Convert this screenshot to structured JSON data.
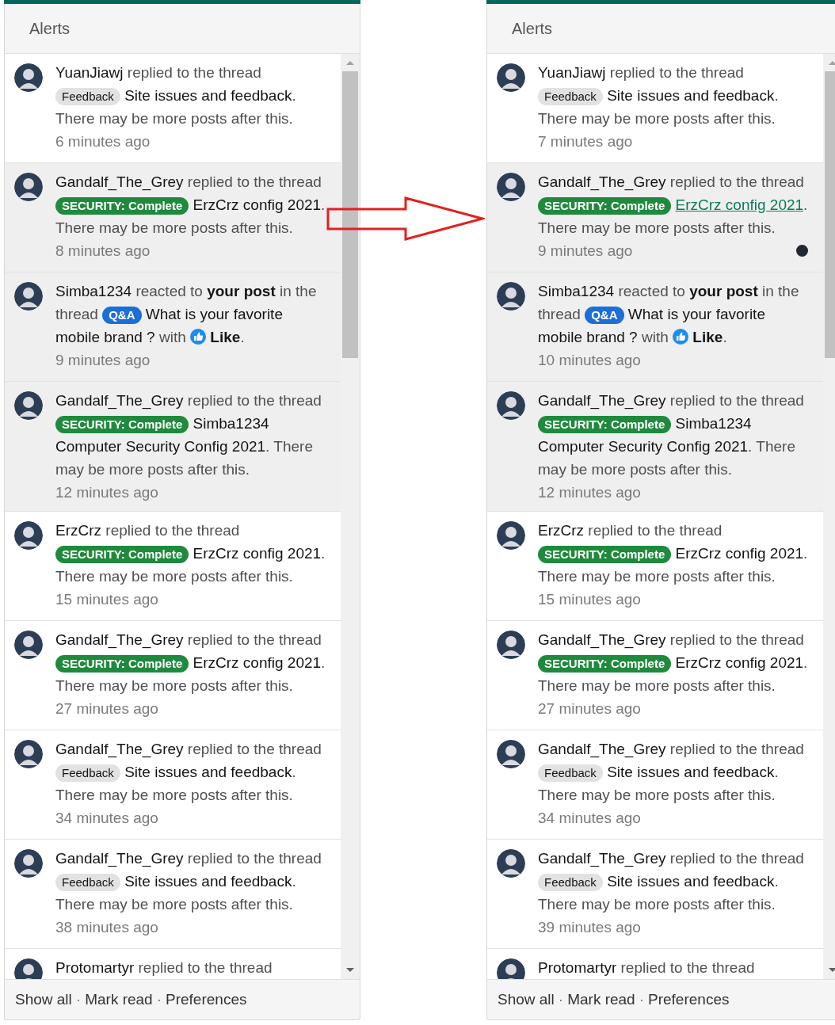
{
  "panels": [
    {
      "title": "Alerts",
      "items": [
        {
          "unread": false,
          "hovered": false,
          "segments": [
            {
              "kind": "user",
              "text": "YuanJiawj"
            },
            {
              "kind": "text",
              "text": " replied to the thread "
            },
            {
              "kind": "label",
              "text": "Feedback"
            },
            {
              "kind": "title",
              "text": "Site issues and feedback"
            },
            {
              "kind": "text",
              "text": ". There may be more posts after this."
            }
          ],
          "time": "6 minutes ago"
        },
        {
          "unread": true,
          "hovered": false,
          "segments": [
            {
              "kind": "user",
              "text": "Gandalf_The_Grey"
            },
            {
              "kind": "text",
              "text": " replied to the thread "
            },
            {
              "kind": "status",
              "text": "SECURITY: Complete"
            },
            {
              "kind": "title",
              "text": "ErzCrz config 2021"
            },
            {
              "kind": "text",
              "text": ". There may be more posts after this."
            }
          ],
          "time": "8 minutes ago"
        },
        {
          "unread": true,
          "hovered": false,
          "segments": [
            {
              "kind": "user",
              "text": "Simba1234"
            },
            {
              "kind": "text",
              "text": " reacted to "
            },
            {
              "kind": "bold",
              "text": "your post"
            },
            {
              "kind": "text",
              "text": " in the thread "
            },
            {
              "kind": "category",
              "text": "Q&A"
            },
            {
              "kind": "title",
              "text": "What is your favorite mobile brand ?"
            },
            {
              "kind": "text",
              "text": " with "
            },
            {
              "kind": "like"
            },
            {
              "kind": "bold",
              "text": "Like"
            },
            {
              "kind": "text",
              "text": "."
            }
          ],
          "time": "9 minutes ago"
        },
        {
          "unread": true,
          "hovered": false,
          "segments": [
            {
              "kind": "user",
              "text": "Gandalf_The_Grey"
            },
            {
              "kind": "text",
              "text": " replied to the thread "
            },
            {
              "kind": "status",
              "text": "SECURITY: Complete"
            },
            {
              "kind": "title",
              "text": "Simba1234 Computer Security Config 2021"
            },
            {
              "kind": "text",
              "text": ". There may be more posts after this."
            }
          ],
          "time": "12 minutes ago"
        },
        {
          "unread": false,
          "hovered": false,
          "segments": [
            {
              "kind": "user",
              "text": "ErzCrz"
            },
            {
              "kind": "text",
              "text": " replied to the thread "
            },
            {
              "kind": "status",
              "text": "SECURITY: Complete"
            },
            {
              "kind": "title",
              "text": "ErzCrz config 2021"
            },
            {
              "kind": "text",
              "text": ". There may be more posts after this."
            }
          ],
          "time": "15 minutes ago"
        },
        {
          "unread": false,
          "hovered": false,
          "segments": [
            {
              "kind": "user",
              "text": "Gandalf_The_Grey"
            },
            {
              "kind": "text",
              "text": " replied to the thread "
            },
            {
              "kind": "status",
              "text": "SECURITY: Complete"
            },
            {
              "kind": "title",
              "text": "ErzCrz config 2021"
            },
            {
              "kind": "text",
              "text": ". There may be more posts after this."
            }
          ],
          "time": "27 minutes ago"
        },
        {
          "unread": false,
          "hovered": false,
          "segments": [
            {
              "kind": "user",
              "text": "Gandalf_The_Grey"
            },
            {
              "kind": "text",
              "text": " replied to the thread "
            },
            {
              "kind": "label",
              "text": "Feedback"
            },
            {
              "kind": "title",
              "text": "Site issues and feedback"
            },
            {
              "kind": "text",
              "text": ". There may be more posts after this."
            }
          ],
          "time": "34 minutes ago"
        },
        {
          "unread": false,
          "hovered": false,
          "segments": [
            {
              "kind": "user",
              "text": "Gandalf_The_Grey"
            },
            {
              "kind": "text",
              "text": " replied to the thread "
            },
            {
              "kind": "label",
              "text": "Feedback"
            },
            {
              "kind": "title",
              "text": "Site issues and feedback"
            },
            {
              "kind": "text",
              "text": ". There may be more posts after this."
            }
          ],
          "time": "38 minutes ago"
        },
        {
          "unread": false,
          "segments": [
            {
              "kind": "user",
              "text": "Protomartyr"
            },
            {
              "kind": "text",
              "text": " replied to the thread"
            }
          ]
        }
      ],
      "footer": [
        "Show all",
        "Mark read",
        "Preferences"
      ],
      "separator": "·"
    },
    {
      "title": "Alerts",
      "items": [
        {
          "unread": false,
          "hovered": false,
          "segments": [
            {
              "kind": "user",
              "text": "YuanJiawj"
            },
            {
              "kind": "text",
              "text": " replied to the thread "
            },
            {
              "kind": "label",
              "text": "Feedback"
            },
            {
              "kind": "title",
              "text": "Site issues and feedback"
            },
            {
              "kind": "text",
              "text": ". There may be more posts after this."
            }
          ],
          "time": "7 minutes ago"
        },
        {
          "unread": true,
          "hovered": true,
          "segments": [
            {
              "kind": "user",
              "text": "Gandalf_The_Grey"
            },
            {
              "kind": "text",
              "text": " replied to the thread "
            },
            {
              "kind": "status",
              "text": "SECURITY: Complete"
            },
            {
              "kind": "title",
              "text": "ErzCrz config 2021"
            },
            {
              "kind": "text",
              "text": ". There may be more posts after this."
            }
          ],
          "time": "9 minutes ago"
        },
        {
          "unread": true,
          "hovered": false,
          "segments": [
            {
              "kind": "user",
              "text": "Simba1234"
            },
            {
              "kind": "text",
              "text": " reacted to "
            },
            {
              "kind": "bold",
              "text": "your post"
            },
            {
              "kind": "text",
              "text": " in the thread "
            },
            {
              "kind": "category",
              "text": "Q&A"
            },
            {
              "kind": "title",
              "text": "What is your favorite mobile brand ?"
            },
            {
              "kind": "text",
              "text": " with "
            },
            {
              "kind": "like"
            },
            {
              "kind": "bold",
              "text": "Like"
            },
            {
              "kind": "text",
              "text": "."
            }
          ],
          "time": "10 minutes ago"
        },
        {
          "unread": true,
          "hovered": false,
          "segments": [
            {
              "kind": "user",
              "text": "Gandalf_The_Grey"
            },
            {
              "kind": "text",
              "text": " replied to the thread "
            },
            {
              "kind": "status",
              "text": "SECURITY: Complete"
            },
            {
              "kind": "title",
              "text": "Simba1234 Computer Security Config 2021"
            },
            {
              "kind": "text",
              "text": ". There may be more posts after this."
            }
          ],
          "time": "12 minutes ago"
        },
        {
          "unread": false,
          "hovered": false,
          "segments": [
            {
              "kind": "user",
              "text": "ErzCrz"
            },
            {
              "kind": "text",
              "text": " replied to the thread "
            },
            {
              "kind": "status",
              "text": "SECURITY: Complete"
            },
            {
              "kind": "title",
              "text": "ErzCrz config 2021"
            },
            {
              "kind": "text",
              "text": ". There may be more posts after this."
            }
          ],
          "time": "15 minutes ago"
        },
        {
          "unread": false,
          "hovered": false,
          "segments": [
            {
              "kind": "user",
              "text": "Gandalf_The_Grey"
            },
            {
              "kind": "text",
              "text": " replied to the thread "
            },
            {
              "kind": "status",
              "text": "SECURITY: Complete"
            },
            {
              "kind": "title",
              "text": "ErzCrz config 2021"
            },
            {
              "kind": "text",
              "text": ". There may be more posts after this."
            }
          ],
          "time": "27 minutes ago"
        },
        {
          "unread": false,
          "hovered": false,
          "segments": [
            {
              "kind": "user",
              "text": "Gandalf_The_Grey"
            },
            {
              "kind": "text",
              "text": " replied to the thread "
            },
            {
              "kind": "label",
              "text": "Feedback"
            },
            {
              "kind": "title",
              "text": "Site issues and feedback"
            },
            {
              "kind": "text",
              "text": ". There may be more posts after this."
            }
          ],
          "time": "34 minutes ago"
        },
        {
          "unread": false,
          "hovered": false,
          "segments": [
            {
              "kind": "user",
              "text": "Gandalf_The_Grey"
            },
            {
              "kind": "text",
              "text": " replied to the thread "
            },
            {
              "kind": "label",
              "text": "Feedback"
            },
            {
              "kind": "title",
              "text": "Site issues and feedback"
            },
            {
              "kind": "text",
              "text": ". There may be more posts after this."
            }
          ],
          "time": "39 minutes ago"
        },
        {
          "unread": false,
          "segments": [
            {
              "kind": "user",
              "text": "Protomartyr"
            },
            {
              "kind": "text",
              "text": " replied to the thread"
            }
          ]
        }
      ],
      "footer": [
        "Show all",
        "Mark read",
        "Preferences"
      ],
      "separator": "·"
    }
  ]
}
